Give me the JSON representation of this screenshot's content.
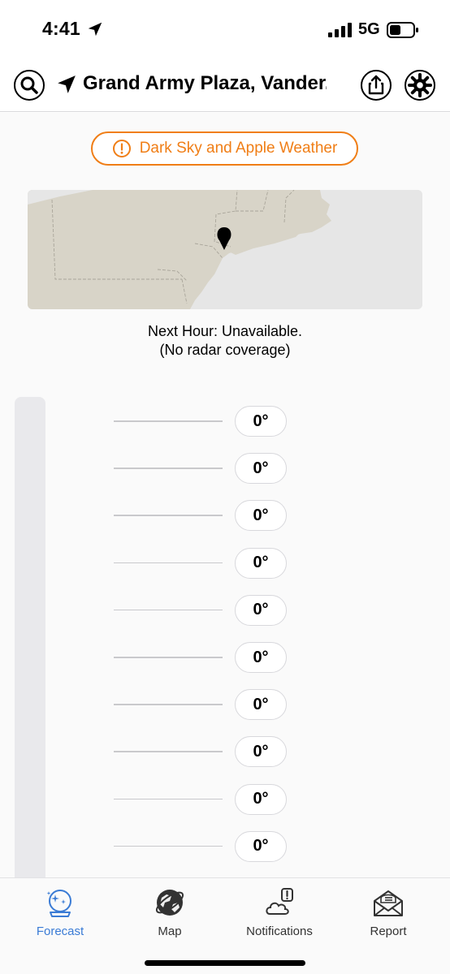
{
  "status_bar": {
    "time": "4:41",
    "network": "5G"
  },
  "header": {
    "location": "Grand Army Plaza, Vander..."
  },
  "source_notice": {
    "label": "Dark Sky and Apple Weather",
    "color": "#f07e16"
  },
  "radar": {
    "line1": "Next Hour: Unavailable.",
    "line2": "(No radar coverage)"
  },
  "temperatures": [
    "0°",
    "0°",
    "0°",
    "0°",
    "0°",
    "0°",
    "0°",
    "0°",
    "0°",
    "0°"
  ],
  "tabs": [
    {
      "label": "Forecast",
      "icon": "crystal-ball-icon",
      "active": true
    },
    {
      "label": "Map",
      "icon": "globe-icon",
      "active": false
    },
    {
      "label": "Notifications",
      "icon": "cloud-alert-icon",
      "active": false
    },
    {
      "label": "Report",
      "icon": "mail-icon",
      "active": false
    }
  ],
  "colors": {
    "accent": "#3a7bd5",
    "warning": "#f07e16"
  }
}
